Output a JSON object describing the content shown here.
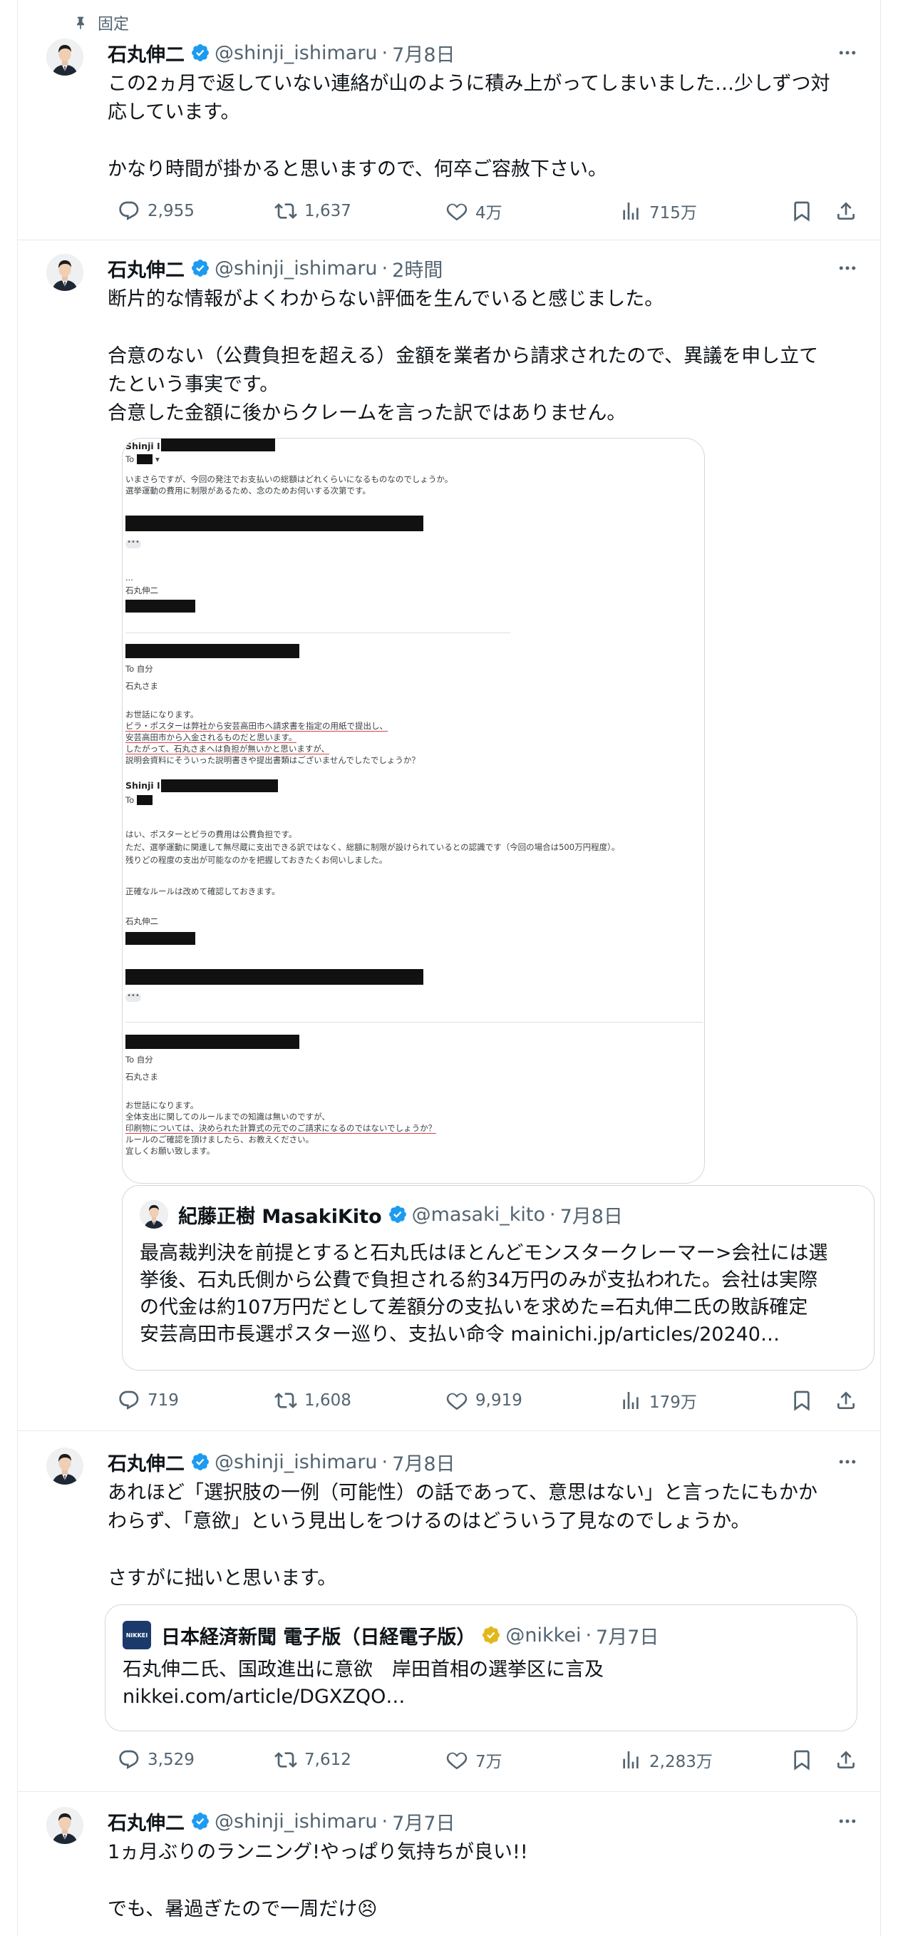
{
  "pinned_label": "固定",
  "tweets": [
    {
      "name": "石丸伸二",
      "handle": "@shinji_ishimaru",
      "time": "7月8日",
      "text": "この2ヵ月で返していない連絡が山のように積み上がってしまいました…少しずつ対\n応しています。\n\nかなり時間が掛かると思いますので、何卒ご容赦下さい。",
      "replies": "2,955",
      "retweets": "1,637",
      "likes": "4万",
      "views": "715万"
    },
    {
      "name": "石丸伸二",
      "handle": "@shinji_ishimaru",
      "time": "2時間",
      "text": "断片的な情報がよくわからない評価を生んでいると感じました。\n\n合意のない（公費負担を超える）金額を業者から請求されたので、異議を申し立て\nたという事実です。\n合意した金額に後からクレームを言った訳ではありません。",
      "replies": "719",
      "retweets": "1,608",
      "likes": "9,919",
      "views": "179万",
      "email": {
        "sender1": "Shinji I",
        "to1": "To",
        "body1": [
          "いまさらですが、今回の発注でお支払いの総額はどれくらいになるものなのでしょうか。",
          "選挙運動の費用に制限があるため、念のためお伺いする次第です。"
        ],
        "ellipsis": "...",
        "sig1": "石丸伸二",
        "to2": "To 自分",
        "greet2": "石丸さま",
        "body2a": "お世話になります。",
        "body2_red": [
          "ビラ・ポスターは弊社から安芸高田市へ請求書を指定の用紙で提出し、",
          "安芸高田市から入金されるものだと思います。",
          "したがって、石丸さまへは負担が無いかと思いますが、"
        ],
        "body2b": "説明会資料にそういった説明書きや提出書類はございませんでしたでしょうか？",
        "sender3": "Shinji I",
        "to3": "To",
        "body3": [
          "はい、ポスターとビラの費用は公費負担です。",
          "ただ、選挙運動に関連して無尽蔵に支出できる訳ではなく、総額に制限が設けられているとの認識です（今回の場合は500万円程度）。",
          "残りどの程度の支出が可能なのかを把握しておきたくお伺いしました。",
          "",
          "正確なルールは改めて確認しておきます。"
        ],
        "sig3": "石丸伸二",
        "to4": "To 自分",
        "greet4": "石丸さま",
        "body4a": [
          "お世話になります。",
          "全体支出に関してのルールまでの知識は無いのですが、"
        ],
        "body4_red": "印刷物については、決められた計算式の元でのご請求になるのではないでしょうか？",
        "body4b": [
          "ルールのご確認を頂けましたら、お教えください。",
          "宜しくお願い致します。"
        ]
      },
      "quote": {
        "name": "紀藤正樹 MasakiKito",
        "handle": "@masaki_kito",
        "time": "7月8日",
        "text": "最高裁判決を前提とすると石丸氏はほとんどモンスタークレーマー>会社には選\n挙後、石丸氏側から公費で負担される約34万円のみが支払われた。会社は実際\nの代金は約107万円だとして差額分の支払いを求めた=石丸伸二氏の敗訴確定\n安芸高田市長選ポスター巡り、支払い命令 mainichi.jp/articles/20240…"
      }
    },
    {
      "name": "石丸伸二",
      "handle": "@shinji_ishimaru",
      "time": "7月8日",
      "text": "あれほど「選択肢の一例（可能性）の話であって、意思はない」と言ったにもかか\nわらず、「意欲」という見出しをつけるのはどういう了見なのでしょうか。\n\nさすがに拙いと思います。",
      "replies": "3,529",
      "retweets": "7,612",
      "likes": "7万",
      "views": "2,283万",
      "quote": {
        "name": "日本経済新聞 電子版（日経電子版）",
        "handle": "@nikkei",
        "time": "7月7日",
        "logo_text": "NIKKEI",
        "text": "石丸伸二氏、国政進出に意欲　岸田首相の選挙区に言及\nnikkei.com/article/DGXZQO…"
      }
    },
    {
      "name": "石丸伸二",
      "handle": "@shinji_ishimaru",
      "time": "7月7日",
      "text": "1ヵ月ぶりのランニング!やっぱり気持ちが良い!!\n\nでも、暑過ぎたので一周だけ😣"
    }
  ],
  "colors": {
    "verified_blue": "#1d9bf0",
    "verified_gold": "#e2b719",
    "secondary": "#536471",
    "border": "#e6e9ec"
  }
}
